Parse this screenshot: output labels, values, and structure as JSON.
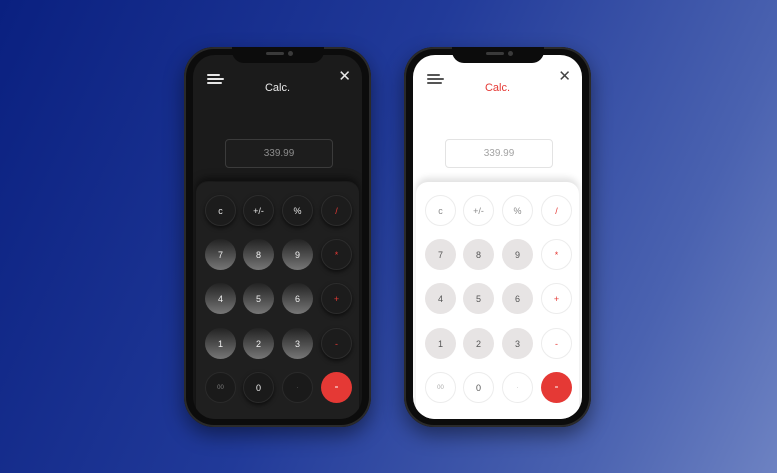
{
  "colors": {
    "accent": "#e53935",
    "dark_bg": "#1b1b1b",
    "light_bg": "#ffffff"
  },
  "phones": [
    {
      "theme": "dark",
      "title": "Calc.",
      "display": "339.99",
      "menu_icon": "hamburger-menu-icon",
      "close_icon": "close-icon",
      "close_glyph": "✕",
      "keys": {
        "clear": "c",
        "sign": "+/-",
        "percent": "%",
        "divide": "/",
        "seven": "7",
        "eight": "8",
        "nine": "9",
        "multiply": "*",
        "four": "4",
        "five": "5",
        "six": "6",
        "plus": "+",
        "one": "1",
        "two": "2",
        "three": "3",
        "minus": "-",
        "double_zero": "00",
        "zero": "0",
        "decimal": "·",
        "equals": "="
      }
    },
    {
      "theme": "light",
      "title": "Calc.",
      "display": "339.99",
      "menu_icon": "hamburger-menu-icon",
      "close_icon": "close-icon",
      "close_glyph": "✕",
      "keys": {
        "clear": "c",
        "sign": "+/-",
        "percent": "%",
        "divide": "/",
        "seven": "7",
        "eight": "8",
        "nine": "9",
        "multiply": "*",
        "four": "4",
        "five": "5",
        "six": "6",
        "plus": "+",
        "one": "1",
        "two": "2",
        "three": "3",
        "minus": "-",
        "double_zero": "00",
        "zero": "0",
        "decimal": "·",
        "equals": "="
      }
    }
  ]
}
